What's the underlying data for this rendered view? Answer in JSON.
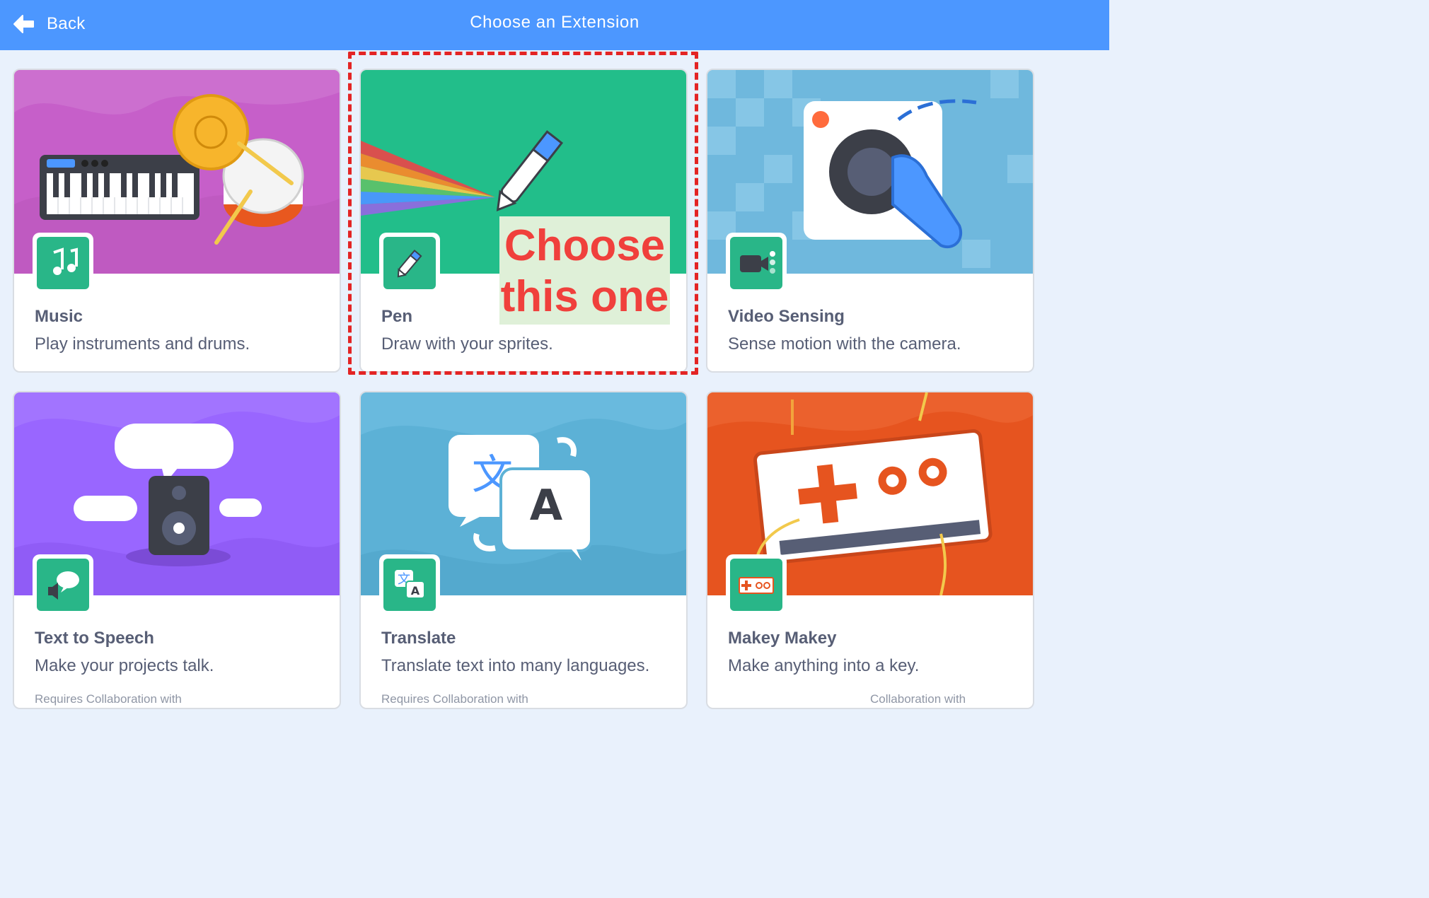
{
  "header": {
    "back_label": "Back",
    "title": "Choose an Extension",
    "background": "#4c97ff"
  },
  "cards": [
    {
      "title": "Music",
      "description": "Play instruments and drums.",
      "footer": "",
      "icon": "music-notes-icon",
      "art_color": "#c65fc9"
    },
    {
      "title": "Pen",
      "description": "Draw with your sprites.",
      "footer": "",
      "icon": "pen-icon",
      "art_color": "#22be8a"
    },
    {
      "title": "Video Sensing",
      "description": "Sense motion with the camera.",
      "footer": "",
      "icon": "video-camera-icon",
      "art_color": "#6fb8dd"
    },
    {
      "title": "Text to Speech",
      "description": "Make your projects talk.",
      "footer": "Requires          Collaboration with",
      "icon": "speech-bubble-speaker-icon",
      "art_color": "#9966ff"
    },
    {
      "title": "Translate",
      "description": "Translate text into many languages.",
      "footer": "Requires          Collaboration with",
      "icon": "translate-icon",
      "art_color": "#5cb1d6"
    },
    {
      "title": "Makey Makey",
      "description": "Make anything into a key.",
      "footer": "Collaboration with",
      "icon": "makey-makey-board-icon",
      "art_color": "#e6541f"
    }
  ],
  "annotation": {
    "text_line1": "Choose",
    "text_line2": "this one",
    "text_color": "#f0403c",
    "highlight_color": "#e32424"
  },
  "colors": {
    "page_background": "#e9f1fc",
    "icon_tile": "#29b688",
    "text": "#575e75"
  }
}
